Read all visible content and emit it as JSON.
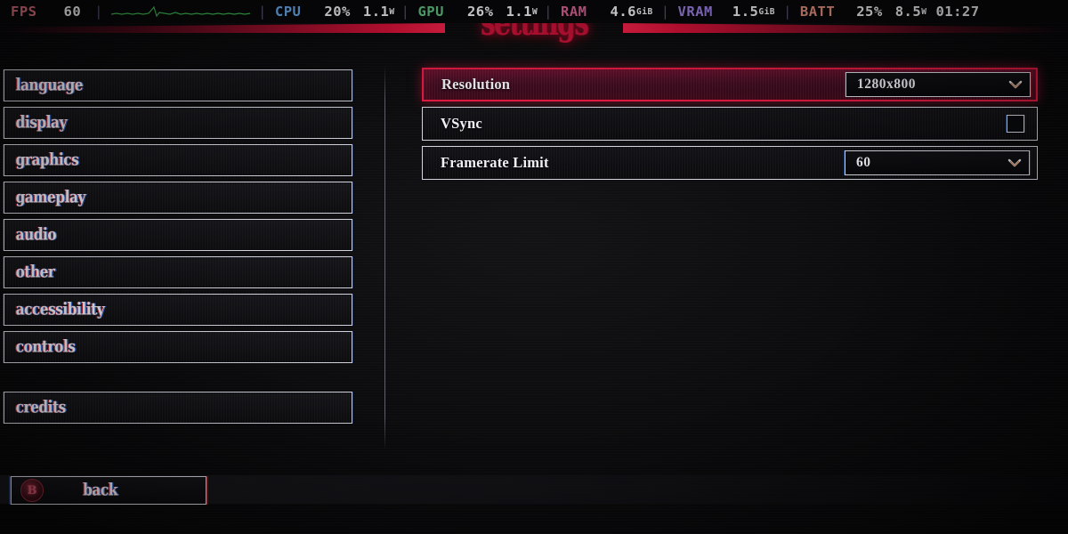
{
  "hud": {
    "fps": {
      "label": "FPS",
      "value": "60",
      "label_color": "#e2707f",
      "graph_icon": "sparkline-graph-icon"
    },
    "cpu": {
      "label": "CPU",
      "usage": "20%",
      "power": "1.1",
      "power_unit": "W",
      "label_color": "#6aa8e8"
    },
    "gpu": {
      "label": "GPU",
      "usage": "26%",
      "power": "1.1",
      "power_unit": "W",
      "label_color": "#5fbf80"
    },
    "ram": {
      "label": "RAM",
      "value": "4.6",
      "unit": "GiB",
      "label_color": "#d85f93"
    },
    "vram": {
      "label": "VRAM",
      "value": "1.5",
      "unit": "GiB",
      "label_color": "#9b7fe0"
    },
    "batt": {
      "label": "BATT",
      "percent": "25%",
      "power": "8.5",
      "power_unit": "W",
      "time": "01:27",
      "label_color": "#e2917f"
    },
    "separator": "|"
  },
  "title": "settings",
  "accent_color": "#e61b43",
  "sidebar": {
    "items": [
      {
        "label": "language",
        "name": "sidebar-item-language"
      },
      {
        "label": "display",
        "name": "sidebar-item-display"
      },
      {
        "label": "graphics",
        "name": "sidebar-item-graphics"
      },
      {
        "label": "gameplay",
        "name": "sidebar-item-gameplay"
      },
      {
        "label": "audio",
        "name": "sidebar-item-audio"
      },
      {
        "label": "other",
        "name": "sidebar-item-other"
      },
      {
        "label": "accessibility",
        "name": "sidebar-item-accessibility"
      },
      {
        "label": "controls",
        "name": "sidebar-item-controls"
      }
    ],
    "credits": {
      "label": "credits"
    }
  },
  "back_button": {
    "label": "back",
    "glyph": "B",
    "glyph_icon": "controller-b-button-icon"
  },
  "panel": {
    "rows": [
      {
        "label": "Resolution",
        "control": "dropdown",
        "value": "1280x800",
        "selected": true,
        "chevron_icon": "chevron-down-icon"
      },
      {
        "label": "VSync",
        "control": "checkbox",
        "checked": false,
        "selected": false
      },
      {
        "label": "Framerate Limit",
        "control": "dropdown",
        "value": "60",
        "selected": false,
        "chevron_icon": "chevron-down-icon"
      }
    ]
  }
}
